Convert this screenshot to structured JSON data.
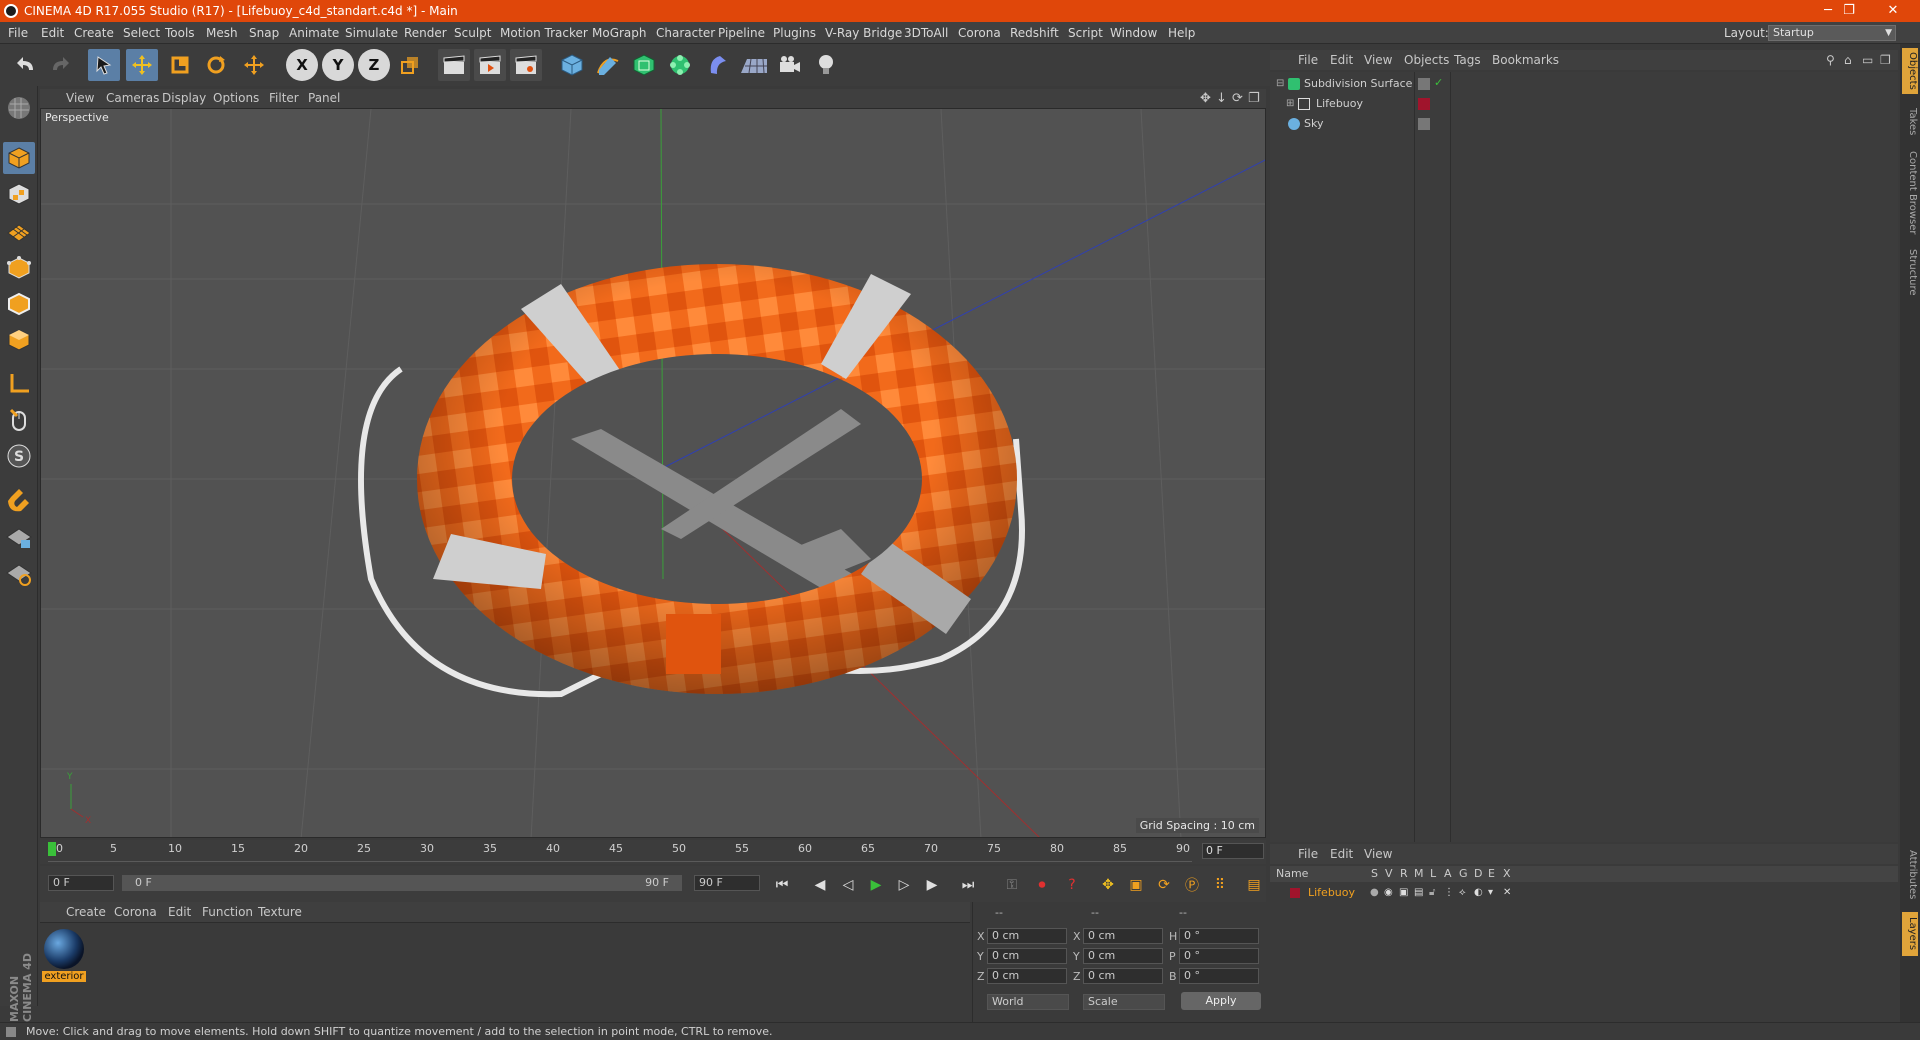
{
  "titlebar": {
    "title": "CINEMA 4D R17.055 Studio (R17) - [Lifebuoy_c4d_standart.c4d *] - Main",
    "minimize": "─",
    "restore": "❐",
    "close": "✕"
  },
  "menubar": {
    "items": [
      "File",
      "Edit",
      "Create",
      "Select",
      "Tools",
      "Mesh",
      "Snap",
      "Animate",
      "Simulate",
      "Render",
      "Sculpt",
      "Motion Tracker",
      "MoGraph",
      "Character",
      "Pipeline",
      "Plugins",
      "V-Ray Bridge",
      "3DToAll",
      "Corona",
      "Redshift",
      "Script",
      "Window",
      "Help"
    ],
    "layout_label": "Layout:",
    "layout_value": "Startup"
  },
  "toolbar": {
    "axis_x": "X",
    "axis_y": "Y",
    "axis_z": "Z"
  },
  "viewport": {
    "menu": [
      "View",
      "Cameras",
      "Display",
      "Options",
      "Filter",
      "Panel"
    ],
    "label": "Perspective",
    "grid_spacing": "Grid Spacing : 10 cm",
    "axis_y": "Y",
    "axis_x": "X"
  },
  "timeline": {
    "ticks": [
      "0",
      "5",
      "10",
      "15",
      "20",
      "25",
      "30",
      "35",
      "40",
      "45",
      "50",
      "55",
      "60",
      "65",
      "70",
      "75",
      "80",
      "85",
      "90"
    ],
    "current_frame": "0 F"
  },
  "transport": {
    "start_frame": "0 F",
    "range_start": "0 F",
    "range_end": "90 F",
    "end_frame": "90 F"
  },
  "materials": {
    "menu": [
      "Create",
      "Corona",
      "Edit",
      "Function",
      "Texture"
    ],
    "items": [
      {
        "name": "exterior"
      }
    ]
  },
  "coords": {
    "headers": [
      "--",
      "--",
      "--"
    ],
    "rows": [
      {
        "a": "X",
        "av": "0 cm",
        "b": "X",
        "bv": "0 cm",
        "c": "H",
        "cv": "0 °"
      },
      {
        "a": "Y",
        "av": "0 cm",
        "b": "Y",
        "bv": "0 cm",
        "c": "P",
        "cv": "0 °"
      },
      {
        "a": "Z",
        "av": "0 cm",
        "b": "Z",
        "bv": "0 cm",
        "c": "B",
        "cv": "0 °"
      }
    ],
    "mode": "World",
    "size_mode": "Scale",
    "apply": "Apply"
  },
  "objects": {
    "menu": [
      "File",
      "Edit",
      "View",
      "Objects",
      "Tags",
      "Bookmarks"
    ],
    "items": [
      {
        "name": "Subdivision Surface"
      },
      {
        "name": "Lifebuoy"
      },
      {
        "name": "Sky"
      }
    ]
  },
  "layers": {
    "menu": [
      "File",
      "Edit",
      "View"
    ],
    "columns": [
      "Name",
      "S",
      "V",
      "R",
      "M",
      "L",
      "A",
      "G",
      "D",
      "E",
      "X"
    ],
    "items": [
      {
        "name": "Lifebuoy",
        "color": "#a0142c"
      }
    ]
  },
  "side_tabs": [
    "Objects",
    "Takes",
    "Content Browser",
    "Structure",
    "Attributes",
    "Layers"
  ],
  "maxon": "MAXON CINEMA 4D",
  "status": "Move: Click and drag to move elements. Hold down SHIFT to quantize movement / add to the selection in point mode, CTRL to remove.",
  "colors": {
    "accent": "#e0470a",
    "lifebuoy": "#f26a1b",
    "band": "#b8b8b8"
  }
}
